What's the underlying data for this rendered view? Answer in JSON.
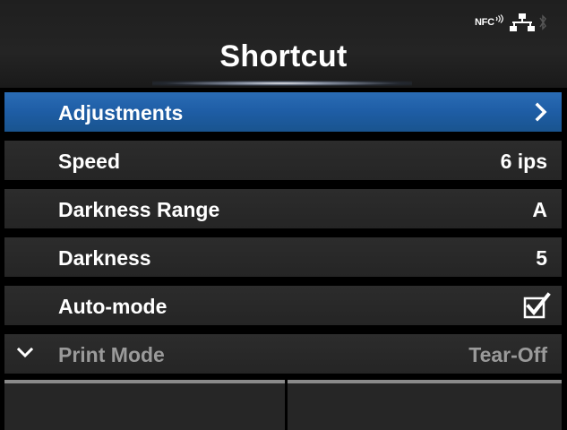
{
  "header": {
    "title": "Shortcut",
    "nfc_label": "NFC",
    "icons": [
      "nfc-icon",
      "network-icon",
      "bluetooth-icon"
    ]
  },
  "menu": {
    "items": [
      {
        "label": "Adjustments",
        "value": "",
        "indicator": "chevron-right-icon",
        "selected": true
      },
      {
        "label": "Speed",
        "value": "6 ips"
      },
      {
        "label": "Darkness Range",
        "value": "A"
      },
      {
        "label": "Darkness",
        "value": "5"
      },
      {
        "label": "Auto-mode",
        "value": "",
        "indicator": "checkbox-checked-icon",
        "checked": true
      },
      {
        "label": "Print Mode",
        "value": "Tear-Off",
        "indicator": "chevron-down-icon"
      }
    ]
  },
  "softkeys": {
    "left": "",
    "right": ""
  },
  "colors": {
    "background": "#000000",
    "row": "#282828",
    "selected": "#2060a8",
    "text": "#ffffff",
    "dim_text": "#9a9a9a"
  }
}
